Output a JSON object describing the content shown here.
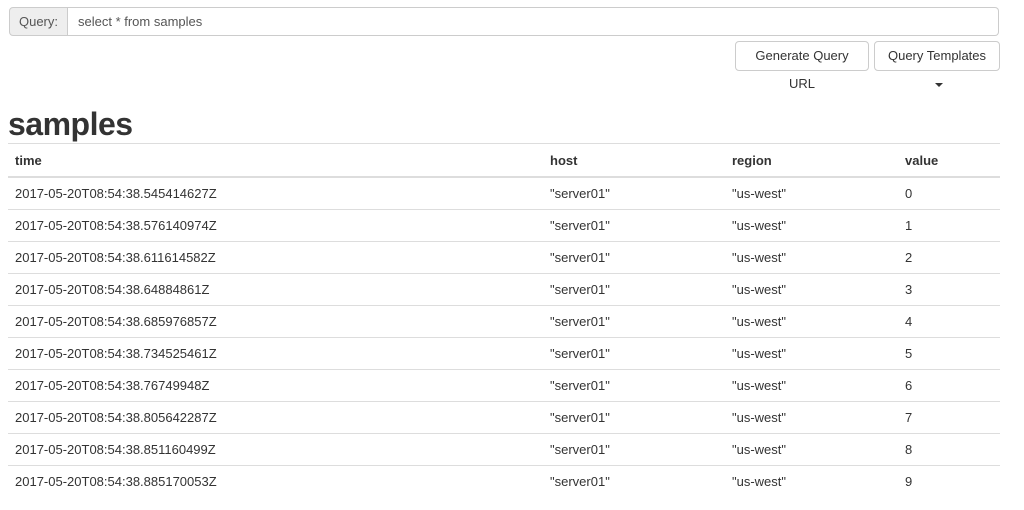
{
  "query": {
    "label": "Query:",
    "value": "select * from samples"
  },
  "buttons": {
    "generate_url": "Generate Query URL",
    "templates": "Query Templates"
  },
  "result": {
    "title": "samples",
    "columns": [
      "time",
      "host",
      "region",
      "value"
    ],
    "rows": [
      [
        "2017-05-20T08:54:38.545414627Z",
        "\"server01\"",
        "\"us-west\"",
        "0"
      ],
      [
        "2017-05-20T08:54:38.576140974Z",
        "\"server01\"",
        "\"us-west\"",
        "1"
      ],
      [
        "2017-05-20T08:54:38.611614582Z",
        "\"server01\"",
        "\"us-west\"",
        "2"
      ],
      [
        "2017-05-20T08:54:38.64884861Z",
        "\"server01\"",
        "\"us-west\"",
        "3"
      ],
      [
        "2017-05-20T08:54:38.685976857Z",
        "\"server01\"",
        "\"us-west\"",
        "4"
      ],
      [
        "2017-05-20T08:54:38.734525461Z",
        "\"server01\"",
        "\"us-west\"",
        "5"
      ],
      [
        "2017-05-20T08:54:38.76749948Z",
        "\"server01\"",
        "\"us-west\"",
        "6"
      ],
      [
        "2017-05-20T08:54:38.805642287Z",
        "\"server01\"",
        "\"us-west\"",
        "7"
      ],
      [
        "2017-05-20T08:54:38.851160499Z",
        "\"server01\"",
        "\"us-west\"",
        "8"
      ],
      [
        "2017-05-20T08:54:38.885170053Z",
        "\"server01\"",
        "\"us-west\"",
        "9"
      ]
    ]
  }
}
